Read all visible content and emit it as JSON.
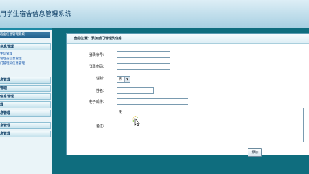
{
  "app": {
    "title": "用学生宿舍信息管理系统"
  },
  "sidebar": {
    "header": "宿舍信息管理系统",
    "categories": [
      {
        "label": "信息管理",
        "items": [
          "生信管理",
          "管理员信息管理",
          "门管理员信息管理"
        ]
      },
      {
        "label": "息管理",
        "items": []
      },
      {
        "label": "管理",
        "items": []
      },
      {
        "label": "信息管理",
        "items": []
      },
      {
        "label": "理",
        "items": []
      },
      {
        "label": "息管理",
        "items": []
      },
      {
        "label": "息管理",
        "items": []
      },
      {
        "label": "息管理",
        "items": []
      }
    ]
  },
  "breadcrumb": "当前位置：添加部门管理员信息",
  "form": {
    "login_id_label": "登录帐号：",
    "login_id_value": "",
    "password_label": "登录密码：",
    "password_value": "",
    "gender_label": "性别：",
    "gender_value": "男",
    "name_label": "姓名：",
    "name_value": "",
    "email_label": "电子邮件：",
    "email_value": "",
    "notes_label": "备注：",
    "notes_value": "无",
    "submit_label": "添加"
  },
  "icons": {
    "dropdown": "chevron-down-icon",
    "cursor": "mouse-pointer-icon",
    "busy": "loading-spinner-icon"
  },
  "colors": {
    "background": "#0f6d7e",
    "header": "#a8d0e2",
    "panel_header": "#1f5f8c",
    "link": "#0c4fa8"
  }
}
